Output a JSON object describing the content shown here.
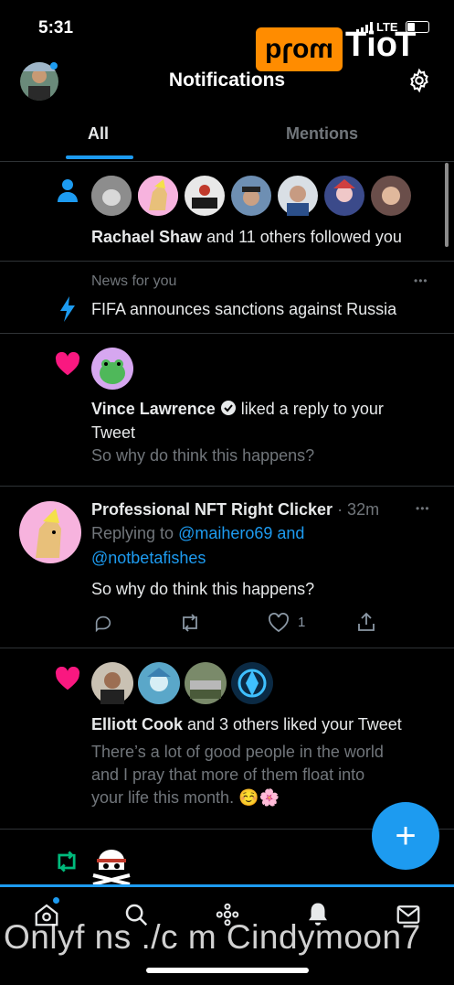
{
  "status_bar": {
    "time": "5:31",
    "network": "LTE"
  },
  "watermark": {
    "badge_text": "moɿq",
    "top_text": "ToiT",
    "bottom_text": "Onlyf ns ./c m Cindymoon7"
  },
  "header": {
    "title": "Notifications"
  },
  "tabs": [
    {
      "label": "All"
    },
    {
      "label": "Mentions"
    }
  ],
  "notifications": {
    "follow": {
      "name": "Rachael Shaw",
      "text": " and 11 others followed you"
    },
    "news": {
      "label": "News for you",
      "text": "FIFA announces sanctions against Russia",
      "more": "•••"
    },
    "like_reply": {
      "name": "Vince Lawrence",
      "action_line1": " liked a reply to your",
      "action_line2": "Tweet",
      "quote": "So why do think this happens?"
    },
    "tweet": {
      "author": "Professional NFT Right Clicker",
      "time": " · 32m",
      "more": "•••",
      "replying_prefix": "Replying to ",
      "replying_user1": "@maihero69 and",
      "replying_user2": "@notbetafishes",
      "body": "So why do think this happens?",
      "like_count": "1"
    },
    "likes_tweet": {
      "name": "Elliott Cook",
      "text": " and 3 others liked your Tweet",
      "quote_line1": "There’s a lot of good people in the world",
      "quote_line2": "and I pray that more of them float into",
      "quote_line3": "your life this month. ☺️🌸"
    }
  },
  "fab": {
    "label": "+"
  },
  "colors": {
    "accent": "#1d9bf0",
    "like": "#f91880",
    "retweet": "#00ba7c",
    "background": "#000000"
  }
}
